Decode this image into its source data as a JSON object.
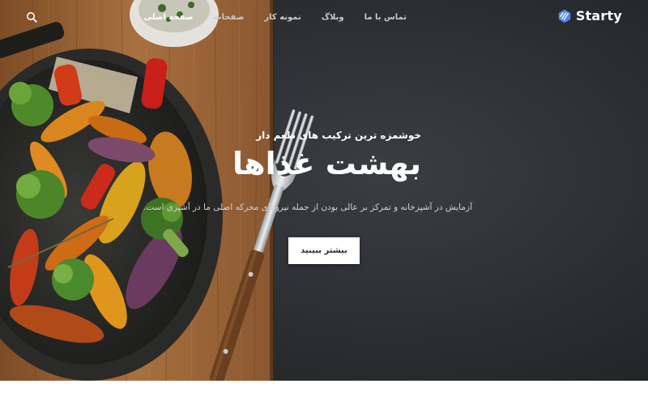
{
  "brand": {
    "name": "Starty",
    "logo_icon": "hexagon-stripes-logo",
    "logo_color": "#4f86f7"
  },
  "nav": {
    "items": [
      {
        "label": "صفحه اصلی",
        "active": true
      },
      {
        "label": "صفحات",
        "active": false
      },
      {
        "label": "نمونه کار",
        "active": false
      },
      {
        "label": "وبلاگ",
        "active": false
      },
      {
        "label": "تماس با ما",
        "active": false
      }
    ],
    "search_icon": "search-icon"
  },
  "hero": {
    "subtitle": "خوشمزه ترین ترکیب های طعم دار",
    "title": "بهشت غذاها",
    "description": "آزمایش در آشپزخانه و تمرکز بر عالی بودن از جمله نیروهای محرکه اصلی ما در آشپزی است.",
    "cta_label": "بیشتر ببینید",
    "background_dark": "#2d3034",
    "wood_color": "#a06a3c"
  }
}
